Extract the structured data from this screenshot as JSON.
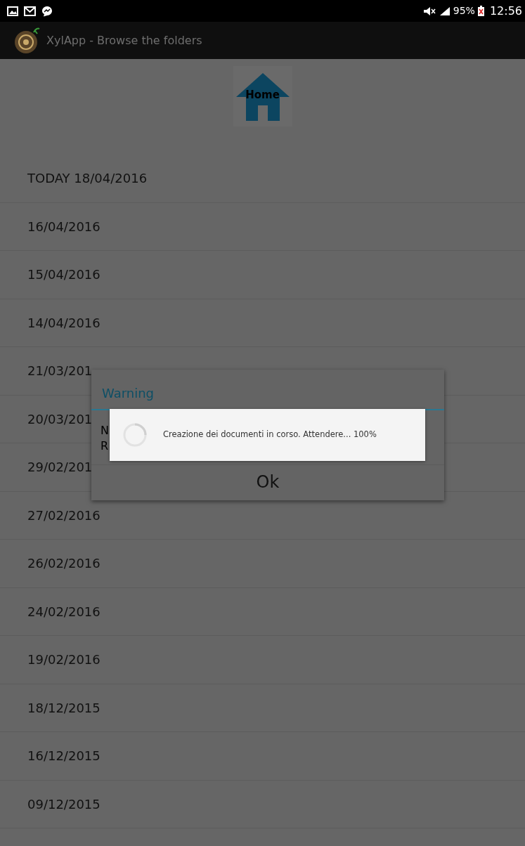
{
  "status_bar": {
    "battery": "95%",
    "time": "12:56"
  },
  "app_bar": {
    "title": "XylApp - Browse the folders"
  },
  "home_button": {
    "label": "Home"
  },
  "folders": [
    {
      "label": "TODAY  18/04/2016"
    },
    {
      "label": "16/04/2016"
    },
    {
      "label": "15/04/2016"
    },
    {
      "label": "14/04/2016"
    },
    {
      "label": "21/03/201"
    },
    {
      "label": "20/03/201"
    },
    {
      "label": "29/02/201"
    },
    {
      "label": "27/02/2016"
    },
    {
      "label": "26/02/2016"
    },
    {
      "label": "24/02/2016"
    },
    {
      "label": "19/02/2016"
    },
    {
      "label": "18/12/2015"
    },
    {
      "label": "16/12/2015"
    },
    {
      "label": "09/12/2015"
    }
  ],
  "dialog": {
    "title": "Warning",
    "message_lines": [
      "N",
      "R"
    ],
    "button": "Ok"
  },
  "progress_dialog": {
    "message": "Creazione dei documenti in corso. Attendere... 100%"
  }
}
